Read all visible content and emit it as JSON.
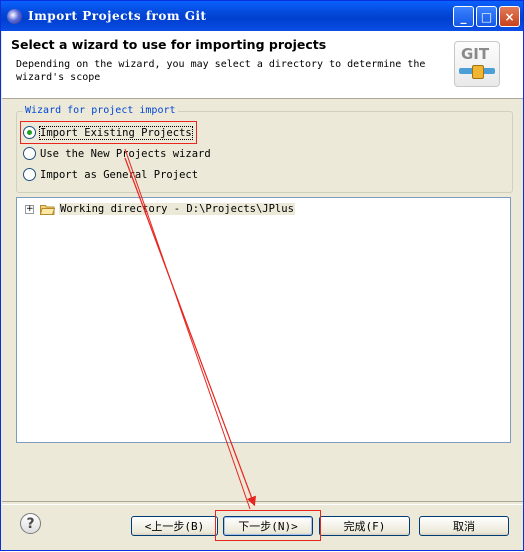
{
  "window": {
    "title": "Import Projects from Git",
    "buttons": {
      "minimize": "_",
      "maximize": "□",
      "close": "×"
    }
  },
  "header": {
    "title": "Select a wizard to use for importing projects",
    "description": "Depending on the wizard, you may select a directory to determine the wizard's scope",
    "logo_text": "GIT"
  },
  "wizard_group": {
    "label": "Wizard for project import",
    "options": [
      {
        "label": "Import Existing Projects",
        "selected": true
      },
      {
        "label": "Use the New Projects wizard",
        "selected": false
      },
      {
        "label": "Import as General Project",
        "selected": false
      }
    ]
  },
  "tree": {
    "items": [
      {
        "label": "Working directory - D:\\Projects\\JPlus",
        "expander": "+"
      }
    ]
  },
  "footer": {
    "help_label": "?",
    "back_label": "<上一步(B)",
    "next_label": "下一步(N)>",
    "finish_label": "完成(F)",
    "cancel_label": "取消"
  },
  "colors": {
    "annotation": "#e8251f",
    "titlebar": "#0a4fe6",
    "dialog_bg": "#ece9d8"
  }
}
